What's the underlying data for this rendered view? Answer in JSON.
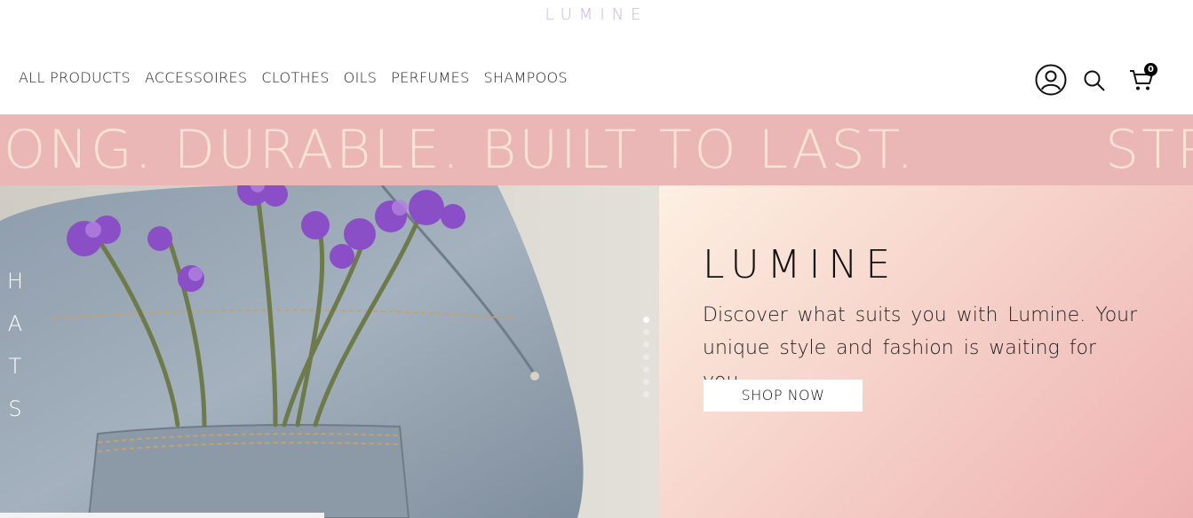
{
  "brand": {
    "name": "LUMINE",
    "color": "#c9b3ea"
  },
  "nav": {
    "items": [
      {
        "label": "ALL PRODUCTS"
      },
      {
        "label": "ACCESSOIRES"
      },
      {
        "label": "CLOTHES"
      },
      {
        "label": "OILS"
      },
      {
        "label": "PERFUMES"
      },
      {
        "label": "SHAMPOOS"
      }
    ]
  },
  "header_icons": {
    "user": "user-icon",
    "search": "search-icon",
    "cart": "cart-icon",
    "cart_count": "0"
  },
  "marquee": {
    "text": "ONG. DURABLE. BUILT TO LAST.",
    "next_text": "STR",
    "background": "#ebb7b6",
    "text_color": "#fbe4d6"
  },
  "hero": {
    "vertical_label": [
      "H",
      "A",
      "T",
      "S"
    ],
    "slides_count": 7,
    "active_slide": 1,
    "title": "LUMINE",
    "description": "Discover what suits you with Lumine. Your unique style and fashion is waiting for you.",
    "cta_label": "SHOP NOW"
  }
}
